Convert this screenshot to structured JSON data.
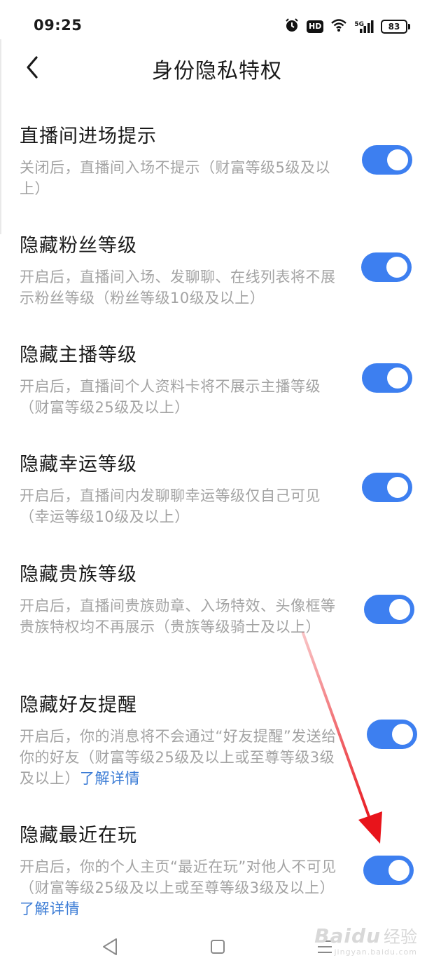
{
  "status_bar": {
    "time": "09:25",
    "hd_label": "HD",
    "network_label": "5G",
    "battery_level": "83",
    "icons": [
      "alarm-icon",
      "wifi-icon",
      "signal-icon",
      "battery-icon"
    ]
  },
  "header": {
    "title": "身份隐私特权",
    "back_icon": "chevron-left-icon"
  },
  "settings": [
    {
      "title": "直播间进场提示",
      "desc": "关闭后，直播间入场不提示（财富等级5级及以上）",
      "enabled": true
    },
    {
      "title": "隐藏粉丝等级",
      "desc": "开启后，直播间入场、发聊聊、在线列表将不展示粉丝等级（粉丝等级10级及以上）",
      "enabled": true
    },
    {
      "title": "隐藏主播等级",
      "desc": "开启后，直播间个人资料卡将不展示主播等级（财富等级25级及以上）",
      "enabled": true
    },
    {
      "title": "隐藏幸运等级",
      "desc": "开启后，直播间内发聊聊幸运等级仅自己可见（幸运等级10级及以上）",
      "enabled": true
    },
    {
      "title": "隐藏贵族等级",
      "desc": "开启后，直播间贵族勋章、入场特效、头像框等贵族特权均不再展示（贵族等级骑士及以上）",
      "enabled": true
    },
    {
      "title": "隐藏好友提醒",
      "desc": "开启后，你的消息将不会通过“好友提醒”发送给你的好友（财富等级25级及以上或至尊等级3级及以上）",
      "link": "了解详情",
      "enabled": true
    },
    {
      "title": "隐藏最近在玩",
      "desc": "开启后，你的个人主页“最近在玩”对他人不可见（财富等级25级及以上或至尊等级3级及以上）",
      "link": "了解详情",
      "enabled": true
    }
  ],
  "bottom_nav": {
    "icons": [
      "back-triangle-icon",
      "home-square-icon",
      "menu-lines-icon"
    ]
  },
  "annotation": {
    "color": "#e8141b"
  },
  "watermark": {
    "brand": "Baidu",
    "cn": "经验",
    "url": "jingyan.baidu.com"
  },
  "colors": {
    "accent": "#3d7ff0",
    "link": "#3a7bd5",
    "desc_text": "#a3a3a3"
  }
}
